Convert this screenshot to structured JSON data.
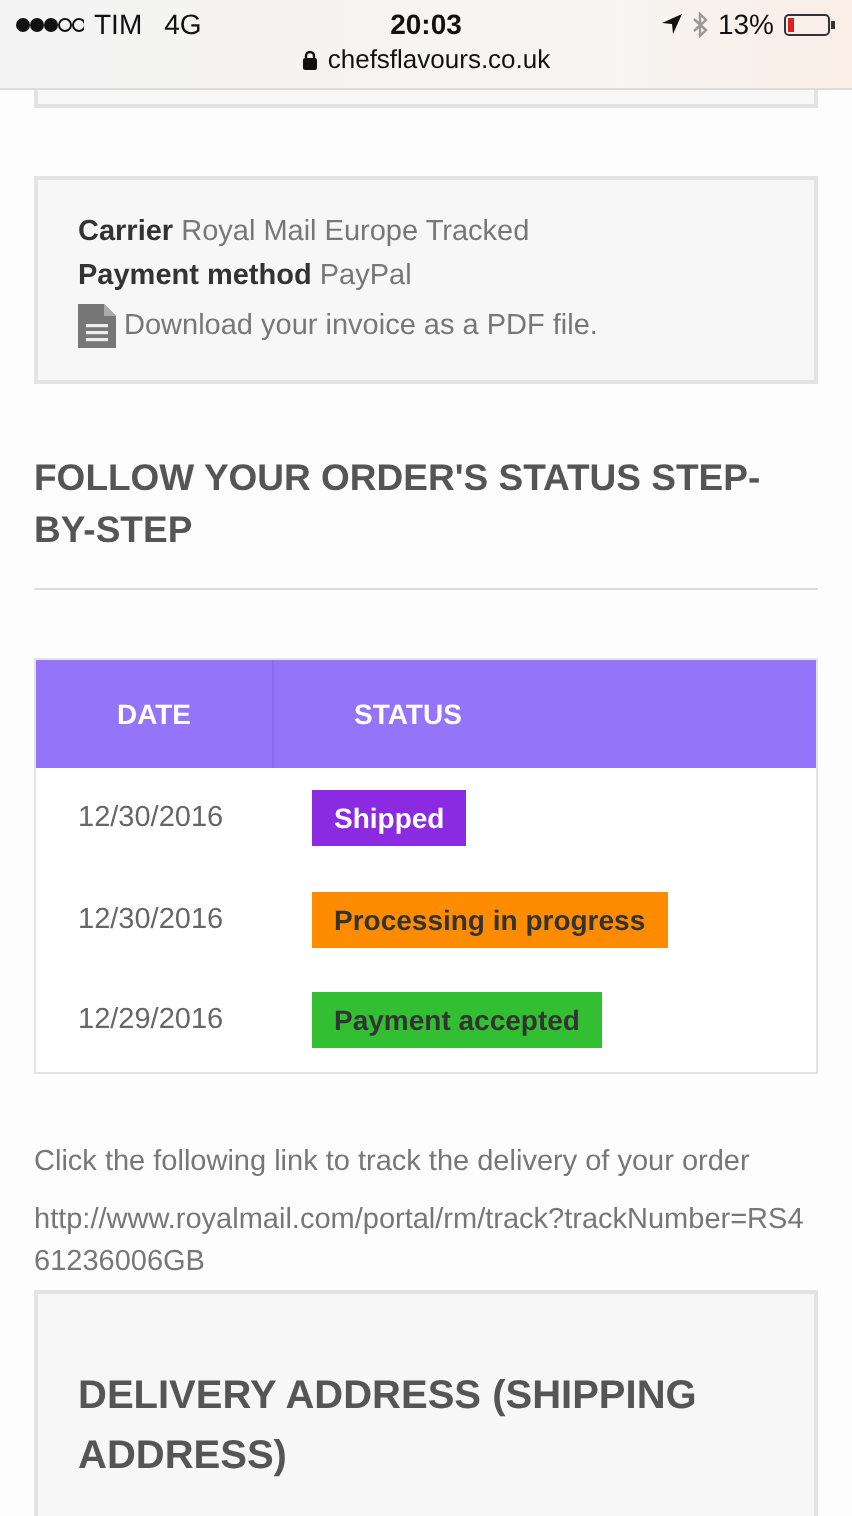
{
  "status_bar": {
    "carrier": "TIM",
    "network": "4G",
    "time": "20:03",
    "battery": "13%"
  },
  "address_bar": {
    "url": "chefsflavours.co.uk"
  },
  "order_info": {
    "fields": [
      {
        "label": "Carrier",
        "value": "Royal Mail Europe Tracked"
      },
      {
        "label": "Payment method",
        "value": "PayPal"
      }
    ],
    "invoice_link": "Download your invoice as a PDF file."
  },
  "status_heading": "FOLLOW YOUR ORDER'S STATUS STEP-BY-STEP",
  "status_table": {
    "columns": [
      "DATE",
      "STATUS"
    ],
    "rows": [
      {
        "date": "12/30/2016",
        "status": "Shipped",
        "color": "#8a2be2"
      },
      {
        "date": "12/30/2016",
        "status": "Processing in progress",
        "color": "#ff8c00"
      },
      {
        "date": "12/29/2016",
        "status": "Payment accepted",
        "color": "#32c032"
      }
    ]
  },
  "tracking": {
    "text": "Click the following link to track the delivery of your order",
    "link": "http://www.royalmail.com/portal/rm/track?trackNumber=RS461236006GB"
  },
  "delivery_address": {
    "heading": "DELIVERY ADDRESS (SHIPPING ADDRESS)"
  }
}
